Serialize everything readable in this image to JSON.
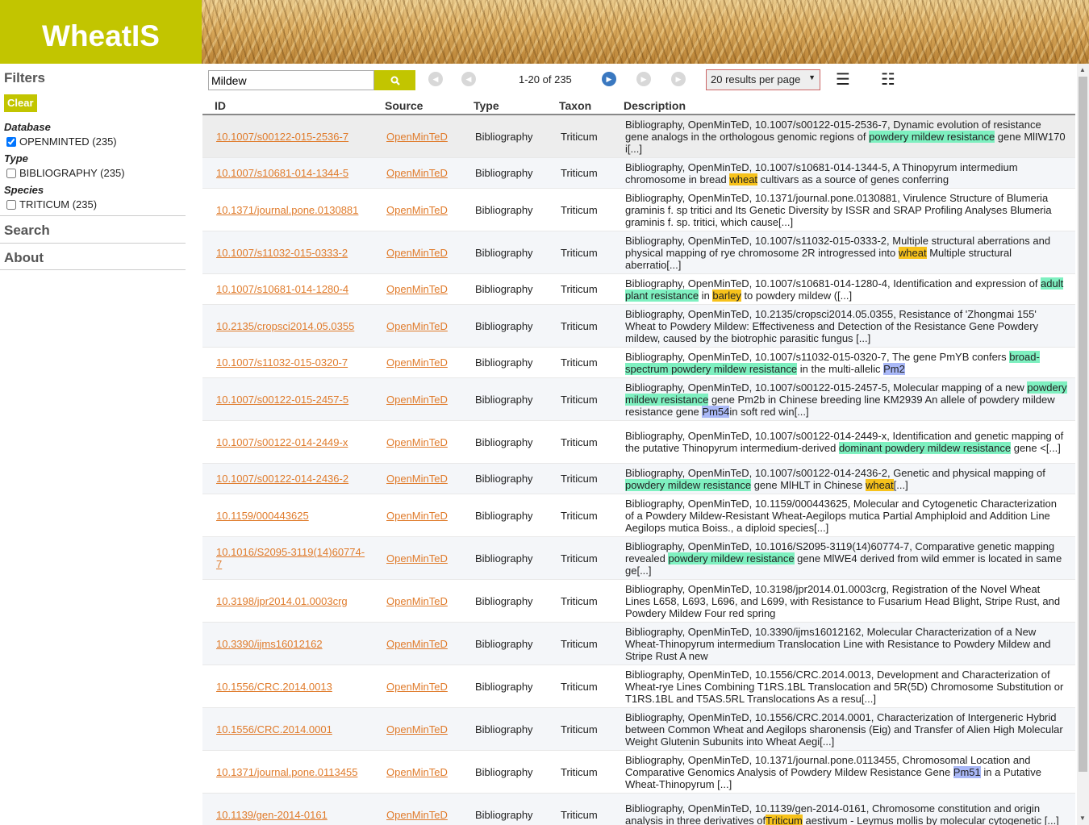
{
  "app": {
    "title": "WheatIS"
  },
  "sidebar": {
    "filters_title": "Filters",
    "clear_label": "Clear",
    "facets": [
      {
        "title": "Database",
        "item": "OPENMINTED (235)",
        "checked": true
      },
      {
        "title": "Type",
        "item": "BIBLIOGRAPHY (235)",
        "checked": false
      },
      {
        "title": "Species",
        "item": "TRITICUM (235)",
        "checked": false
      }
    ],
    "search_label": "Search",
    "about_label": "About"
  },
  "toolbar": {
    "search_value": "Mildew",
    "range": "1-20 of 235",
    "per_page": "20 results per page"
  },
  "table": {
    "headers": {
      "id": "ID",
      "source": "Source",
      "type": "Type",
      "taxon": "Taxon",
      "description": "Description"
    },
    "rows": [
      {
        "id": "10.1007/s00122-015-2536-7",
        "source": "OpenMinTeD",
        "type": "Bibliography",
        "taxon": "Triticum",
        "desc": [
          [
            "Bibliography, OpenMinTeD, 10.1007/s00122-015-2536-7, Dynamic evolution of resistance gene analogs in the orthologous genomic regions of ",
            ""
          ],
          [
            "powdery mildew resistance",
            "g"
          ],
          [
            " gene MlIW170 i[...]",
            ""
          ]
        ]
      },
      {
        "id": "10.1007/s10681-014-1344-5",
        "source": "OpenMinTeD",
        "type": "Bibliography",
        "taxon": "Triticum",
        "desc": [
          [
            "Bibliography, OpenMinTeD, 10.1007/s10681-014-1344-5, A Thinopyrum intermedium chromosome in bread ",
            ""
          ],
          [
            "wheat",
            "y"
          ],
          [
            " cultivars as a source of genes conferring",
            ""
          ]
        ]
      },
      {
        "id": "10.1371/journal.pone.0130881",
        "source": "OpenMinTeD",
        "type": "Bibliography",
        "taxon": "Triticum",
        "desc": [
          [
            "Bibliography, OpenMinTeD, 10.1371/journal.pone.0130881, Virulence Structure of Blumeria graminis f. sp tritici and Its Genetic Diversity by ISSR and SRAP Profiling Analyses Blumeria graminis f. sp. tritici, which cause[...]",
            ""
          ]
        ]
      },
      {
        "id": "10.1007/s11032-015-0333-2",
        "source": "OpenMinTeD",
        "type": "Bibliography",
        "taxon": "Triticum",
        "desc": [
          [
            "Bibliography, OpenMinTeD, 10.1007/s11032-015-0333-2, Multiple structural aberrations and physical mapping of rye chromosome 2R introgressed into ",
            ""
          ],
          [
            "wheat",
            "y"
          ],
          [
            " Multiple structural aberratio[...]",
            ""
          ]
        ]
      },
      {
        "id": "10.1007/s10681-014-1280-4",
        "source": "OpenMinTeD",
        "type": "Bibliography",
        "taxon": "Triticum",
        "desc": [
          [
            "Bibliography, OpenMinTeD, 10.1007/s10681-014-1280-4, Identification and expression of ",
            ""
          ],
          [
            "adult plant resistance",
            "g"
          ],
          [
            " in ",
            ""
          ],
          [
            "barley",
            "y"
          ],
          [
            " to powdery mildew ([...]",
            ""
          ]
        ]
      },
      {
        "id": "10.2135/cropsci2014.05.0355",
        "source": "OpenMinTeD",
        "type": "Bibliography",
        "taxon": "Triticum",
        "desc": [
          [
            "Bibliography, OpenMinTeD, 10.2135/cropsci2014.05.0355, Resistance of 'Zhongmai 155' Wheat to Powdery Mildew: Effectiveness and Detection of the Resistance Gene Powdery mildew, caused by the biotrophic parasitic fungus [...]",
            ""
          ]
        ]
      },
      {
        "id": "10.1007/s11032-015-0320-7",
        "source": "OpenMinTeD",
        "type": "Bibliography",
        "taxon": "Triticum",
        "desc": [
          [
            "Bibliography, OpenMinTeD, 10.1007/s11032-015-0320-7, The gene PmYB confers ",
            ""
          ],
          [
            "broad-spectrum powdery mildew resistance",
            "g"
          ],
          [
            " in the multi-allelic ",
            ""
          ],
          [
            "Pm2",
            "b"
          ]
        ]
      },
      {
        "id": "10.1007/s00122-015-2457-5",
        "source": "OpenMinTeD",
        "type": "Bibliography",
        "taxon": "Triticum",
        "desc": [
          [
            "Bibliography, OpenMinTeD, 10.1007/s00122-015-2457-5, Molecular mapping of a new ",
            ""
          ],
          [
            "powdery mildew resistance",
            "g"
          ],
          [
            " gene Pm2b in Chinese breeding line KM2939 An allele of  powdery mildew resistance  gene ",
            ""
          ],
          [
            "Pm54",
            "b"
          ],
          [
            "in soft red win[...]",
            ""
          ]
        ]
      },
      {
        "id": "10.1007/s00122-014-2449-x",
        "source": "OpenMinTeD",
        "type": "Bibliography",
        "taxon": "Triticum",
        "desc": [
          [
            "Bibliography, OpenMinTeD, 10.1007/s00122-014-2449-x, Identification and genetic mapping of the putative Thinopyrum intermedium-derived ",
            ""
          ],
          [
            "dominant powdery mildew resistance",
            "g"
          ],
          [
            " gene <[...]",
            ""
          ]
        ]
      },
      {
        "id": "10.1007/s00122-014-2436-2",
        "source": "OpenMinTeD",
        "type": "Bibliography",
        "taxon": "Triticum",
        "desc": [
          [
            "Bibliography, OpenMinTeD, 10.1007/s00122-014-2436-2, Genetic and physical mapping of ",
            ""
          ],
          [
            "powdery mildew resistance",
            "g"
          ],
          [
            " gene MlHLT in Chinese ",
            ""
          ],
          [
            "wheat",
            "y"
          ],
          [
            "[...]",
            ""
          ]
        ]
      },
      {
        "id": "10.1159/000443625",
        "source": "OpenMinTeD",
        "type": "Bibliography",
        "taxon": "Triticum",
        "desc": [
          [
            "Bibliography, OpenMinTeD, 10.1159/000443625, Molecular and Cytogenetic Characterization of a Powdery Mildew-Resistant Wheat-Aegilops mutica Partial Amphiploid and Addition Line Aegilops mutica Boiss., a diploid species[...]",
            ""
          ]
        ]
      },
      {
        "id": "10.1016/S2095-3119(14)60774-7",
        "source": "OpenMinTeD",
        "type": "Bibliography",
        "taxon": "Triticum",
        "desc": [
          [
            "Bibliography, OpenMinTeD, 10.1016/S2095-3119(14)60774-7, Comparative genetic mapping revealed ",
            ""
          ],
          [
            "powdery mildew resistance",
            "g"
          ],
          [
            " gene MlWE4 derived from wild emmer is located in same ge[...]",
            ""
          ]
        ]
      },
      {
        "id": "10.3198/jpr2014.01.0003crg",
        "source": "OpenMinTeD",
        "type": "Bibliography",
        "taxon": "Triticum",
        "desc": [
          [
            "Bibliography, OpenMinTeD, 10.3198/jpr2014.01.0003crg, Registration of the Novel Wheat Lines L658, L693, L696, and L699, with Resistance to Fusarium Head Blight, Stripe Rust, and Powdery Mildew Four red spring",
            ""
          ]
        ]
      },
      {
        "id": "10.3390/ijms16012162",
        "source": "OpenMinTeD",
        "type": "Bibliography",
        "taxon": "Triticum",
        "desc": [
          [
            "Bibliography, OpenMinTeD, 10.3390/ijms16012162, Molecular Characterization of a New Wheat-Thinopyrum intermedium Translocation Line with Resistance to Powdery Mildew and Stripe Rust A new",
            ""
          ]
        ]
      },
      {
        "id": "10.1556/CRC.2014.0013",
        "source": "OpenMinTeD",
        "type": "Bibliography",
        "taxon": "Triticum",
        "desc": [
          [
            "Bibliography, OpenMinTeD, 10.1556/CRC.2014.0013, Development and Characterization of Wheat-rye Lines Combining T1RS.1BL Translocation and 5R(5D) Chromosome Substitution or T1RS.1BL and T5AS.5RL Translocations As a resu[...]",
            ""
          ]
        ]
      },
      {
        "id": "10.1556/CRC.2014.0001",
        "source": "OpenMinTeD",
        "type": "Bibliography",
        "taxon": "Triticum",
        "desc": [
          [
            "Bibliography, OpenMinTeD, 10.1556/CRC.2014.0001, Characterization of Intergeneric Hybrid between Common Wheat and Aegilops sharonensis (Eig) and Transfer of Alien High Molecular Weight Glutenin Subunits into Wheat Aegi[...]",
            ""
          ]
        ]
      },
      {
        "id": "10.1371/journal.pone.0113455",
        "source": "OpenMinTeD",
        "type": "Bibliography",
        "taxon": "Triticum",
        "desc": [
          [
            "Bibliography, OpenMinTeD, 10.1371/journal.pone.0113455, Chromosomal Location and Comparative Genomics Analysis of Powdery Mildew Resistance Gene ",
            ""
          ],
          [
            "Pm51",
            "b"
          ],
          [
            " in a Putative Wheat-Thinopyrum [...]",
            ""
          ]
        ]
      },
      {
        "id": "10.1139/gen-2014-0161",
        "source": "OpenMinTeD",
        "type": "Bibliography",
        "taxon": "Triticum",
        "desc": [
          [
            "Bibliography, OpenMinTeD, 10.1139/gen-2014-0161, Chromosome constitution and origin analysis in three derivatives of",
            ""
          ],
          [
            "Triticum",
            "y"
          ],
          [
            " aestivum - Leymus mollis by molecular cytogenetic [...]",
            ""
          ]
        ]
      }
    ]
  }
}
